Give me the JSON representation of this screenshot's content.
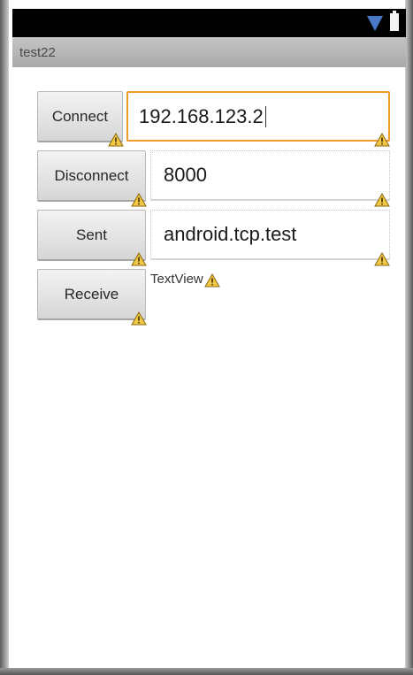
{
  "app": {
    "title": "test22"
  },
  "status_bar": {
    "icons": [
      "wifi-icon",
      "battery-icon"
    ]
  },
  "buttons": {
    "connect": "Connect",
    "disconnect": "Disconnect",
    "sent": "Sent",
    "receive": "Receive"
  },
  "fields": {
    "ip": {
      "value": "192.168.123.2",
      "focused": true
    },
    "port": {
      "value": "8000"
    },
    "message": {
      "value": "android.tcp.test"
    }
  },
  "textview": {
    "text": "TextView"
  },
  "colors": {
    "focus": "#f39a2b",
    "warning": "#f2c744",
    "wifi": "#4a78c8"
  }
}
